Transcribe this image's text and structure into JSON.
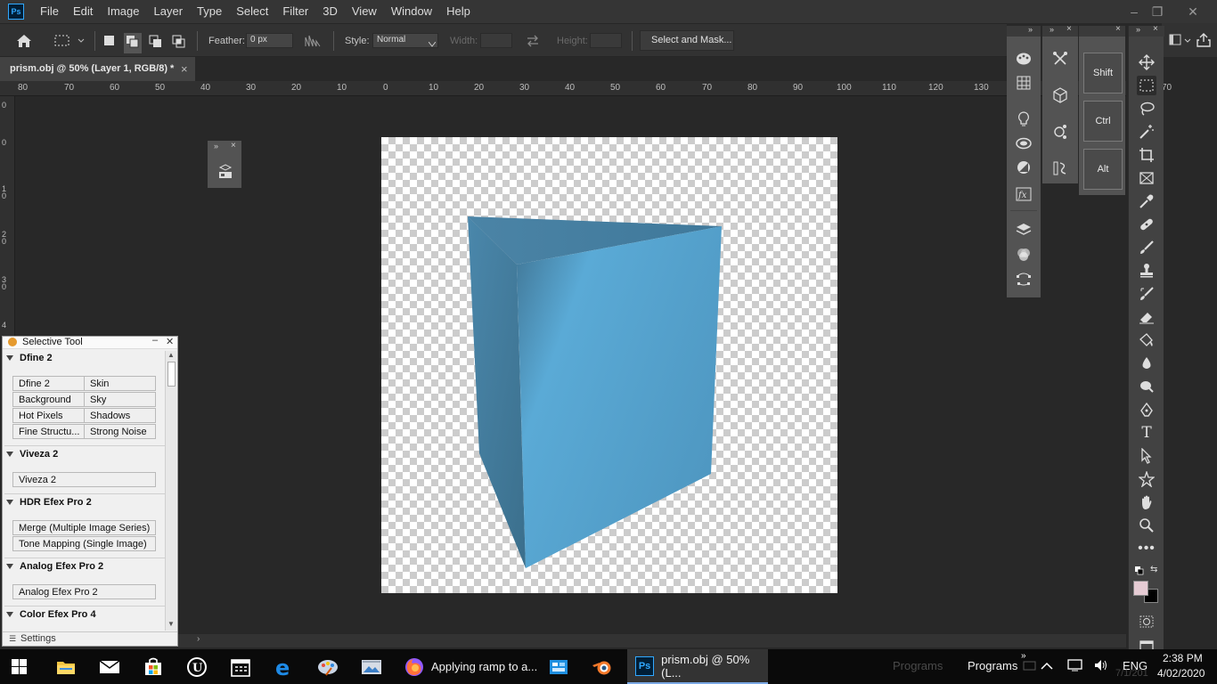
{
  "app": {
    "logo": "Ps"
  },
  "menu": [
    "File",
    "Edit",
    "Image",
    "Layer",
    "Type",
    "Select",
    "Filter",
    "3D",
    "View",
    "Window",
    "Help"
  ],
  "window_controls": {
    "minimize": "–",
    "restore": "❐",
    "close": "✕"
  },
  "options_bar": {
    "feather_label": "Feather:",
    "feather_value": "0 px",
    "style_label": "Style:",
    "style_value": "Normal",
    "width_label": "Width:",
    "height_label": "Height:",
    "select_mask_label": "Select and Mask..."
  },
  "document": {
    "tab_title": "prism.obj @ 50% (Layer 1, RGB/8) *",
    "close_glyph": "×"
  },
  "ruler": {
    "horizontal": [
      "80",
      "70",
      "60",
      "50",
      "40",
      "30",
      "20",
      "10",
      "0",
      "10",
      "20",
      "30",
      "40",
      "50",
      "60",
      "70",
      "80",
      "90",
      "100",
      "110",
      "120",
      "130",
      "70"
    ],
    "vertical": [
      "0",
      "0",
      "1",
      "0",
      "2",
      "0",
      "3",
      "0",
      "4"
    ]
  },
  "selective_tool": {
    "title": "Selective Tool",
    "sections": [
      {
        "name": "Dfine 2",
        "buttons": [
          "Dfine 2",
          "Skin",
          "Background",
          "Sky",
          "Hot Pixels",
          "Shadows",
          "Fine Structu...",
          "Strong Noise"
        ]
      },
      {
        "name": "Viveza 2",
        "buttons": [
          "Viveza 2"
        ]
      },
      {
        "name": "HDR Efex Pro 2",
        "buttons": [
          "Merge (Multiple Image Series)",
          "Tone Mapping (Single Image)"
        ]
      },
      {
        "name": "Analog Efex Pro 2",
        "buttons": [
          "Analog Efex Pro 2"
        ]
      },
      {
        "name": "Color Efex Pro 4",
        "buttons": []
      }
    ],
    "settings_label": "Settings"
  },
  "modifier_keys": [
    "Shift",
    "Ctrl",
    "Alt"
  ],
  "colors": {
    "foreground": "#e6ccd4",
    "background": "#000000",
    "prism_light": "#56a9d3",
    "prism_dark": "#3f7796"
  },
  "taskbar": {
    "firefox_label": "Applying ramp to a...",
    "ps_label": "prism.obj @ 50% (L...",
    "programs_faded": "Programs",
    "programs_label": "Programs",
    "language": "ENG",
    "time": "2:38 PM",
    "date": "4/02/2020",
    "faded_date": "7/1/201"
  }
}
